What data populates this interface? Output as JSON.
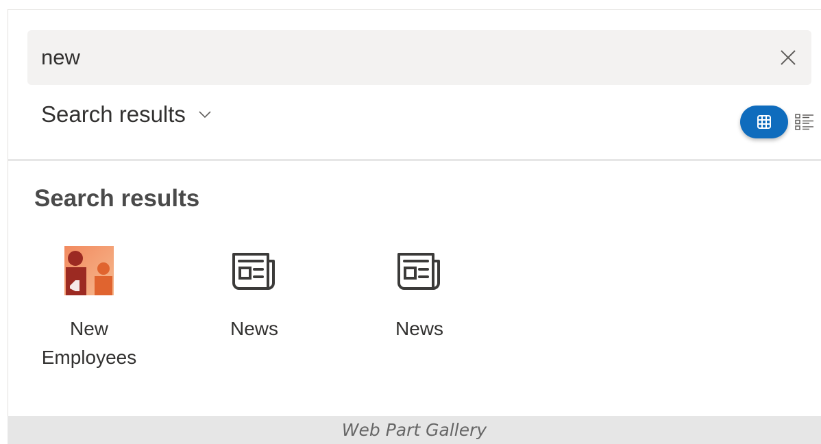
{
  "search": {
    "value": "new",
    "placeholder": "",
    "clear_icon": "close-icon"
  },
  "filter": {
    "selected": "Search results",
    "icon": "chevron-down-icon"
  },
  "view_toggle": {
    "grid_icon": "grid-view-icon",
    "list_icon": "list-view-icon",
    "active": "grid",
    "active_color": "#0f6cbd"
  },
  "section": {
    "heading": "Search results"
  },
  "results": [
    {
      "label": "New Employees",
      "icon": "new-employees-icon"
    },
    {
      "label": "News",
      "icon": "news-icon"
    },
    {
      "label": "News",
      "icon": "news-icon"
    }
  ],
  "footer": {
    "caption": "Web Part Gallery"
  }
}
